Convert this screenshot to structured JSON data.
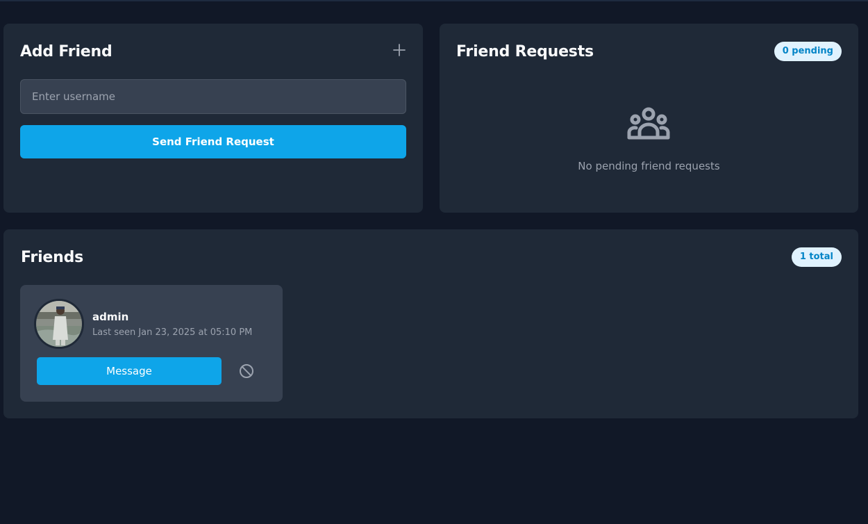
{
  "add_friend": {
    "title": "Add Friend",
    "plus_icon": "plus-icon",
    "input_placeholder": "Enter username",
    "input_value": "",
    "send_label": "Send Friend Request"
  },
  "requests": {
    "title": "Friend Requests",
    "badge": "0 pending",
    "empty_icon": "users-group-icon",
    "empty_text": "No pending friend requests"
  },
  "friends": {
    "title": "Friends",
    "badge": "1 total",
    "items": [
      {
        "name": "admin",
        "last_seen": "Last seen Jan 23, 2025 at 05:10 PM",
        "message_label": "Message",
        "block_icon": "block-icon"
      }
    ]
  },
  "colors": {
    "background": "#111827",
    "card": "#1f2937",
    "inner_card": "#374151",
    "accent": "#0ea5e9",
    "badge_bg": "#e0f2fe",
    "badge_text": "#0284c7"
  }
}
